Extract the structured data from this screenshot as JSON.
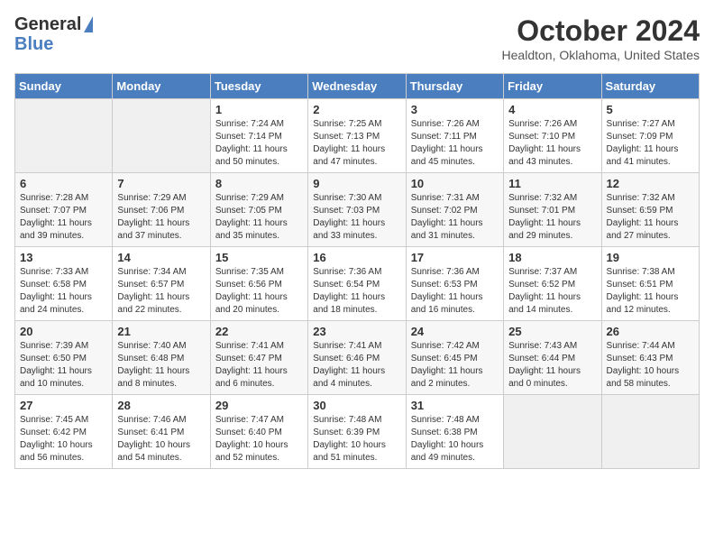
{
  "header": {
    "logo_general": "General",
    "logo_blue": "Blue",
    "title": "October 2024",
    "location": "Healdton, Oklahoma, United States"
  },
  "weekdays": [
    "Sunday",
    "Monday",
    "Tuesday",
    "Wednesday",
    "Thursday",
    "Friday",
    "Saturday"
  ],
  "weeks": [
    [
      {
        "day": "",
        "sunrise": "",
        "sunset": "",
        "daylight": ""
      },
      {
        "day": "",
        "sunrise": "",
        "sunset": "",
        "daylight": ""
      },
      {
        "day": "1",
        "sunrise": "Sunrise: 7:24 AM",
        "sunset": "Sunset: 7:14 PM",
        "daylight": "Daylight: 11 hours and 50 minutes."
      },
      {
        "day": "2",
        "sunrise": "Sunrise: 7:25 AM",
        "sunset": "Sunset: 7:13 PM",
        "daylight": "Daylight: 11 hours and 47 minutes."
      },
      {
        "day": "3",
        "sunrise": "Sunrise: 7:26 AM",
        "sunset": "Sunset: 7:11 PM",
        "daylight": "Daylight: 11 hours and 45 minutes."
      },
      {
        "day": "4",
        "sunrise": "Sunrise: 7:26 AM",
        "sunset": "Sunset: 7:10 PM",
        "daylight": "Daylight: 11 hours and 43 minutes."
      },
      {
        "day": "5",
        "sunrise": "Sunrise: 7:27 AM",
        "sunset": "Sunset: 7:09 PM",
        "daylight": "Daylight: 11 hours and 41 minutes."
      }
    ],
    [
      {
        "day": "6",
        "sunrise": "Sunrise: 7:28 AM",
        "sunset": "Sunset: 7:07 PM",
        "daylight": "Daylight: 11 hours and 39 minutes."
      },
      {
        "day": "7",
        "sunrise": "Sunrise: 7:29 AM",
        "sunset": "Sunset: 7:06 PM",
        "daylight": "Daylight: 11 hours and 37 minutes."
      },
      {
        "day": "8",
        "sunrise": "Sunrise: 7:29 AM",
        "sunset": "Sunset: 7:05 PM",
        "daylight": "Daylight: 11 hours and 35 minutes."
      },
      {
        "day": "9",
        "sunrise": "Sunrise: 7:30 AM",
        "sunset": "Sunset: 7:03 PM",
        "daylight": "Daylight: 11 hours and 33 minutes."
      },
      {
        "day": "10",
        "sunrise": "Sunrise: 7:31 AM",
        "sunset": "Sunset: 7:02 PM",
        "daylight": "Daylight: 11 hours and 31 minutes."
      },
      {
        "day": "11",
        "sunrise": "Sunrise: 7:32 AM",
        "sunset": "Sunset: 7:01 PM",
        "daylight": "Daylight: 11 hours and 29 minutes."
      },
      {
        "day": "12",
        "sunrise": "Sunrise: 7:32 AM",
        "sunset": "Sunset: 6:59 PM",
        "daylight": "Daylight: 11 hours and 27 minutes."
      }
    ],
    [
      {
        "day": "13",
        "sunrise": "Sunrise: 7:33 AM",
        "sunset": "Sunset: 6:58 PM",
        "daylight": "Daylight: 11 hours and 24 minutes."
      },
      {
        "day": "14",
        "sunrise": "Sunrise: 7:34 AM",
        "sunset": "Sunset: 6:57 PM",
        "daylight": "Daylight: 11 hours and 22 minutes."
      },
      {
        "day": "15",
        "sunrise": "Sunrise: 7:35 AM",
        "sunset": "Sunset: 6:56 PM",
        "daylight": "Daylight: 11 hours and 20 minutes."
      },
      {
        "day": "16",
        "sunrise": "Sunrise: 7:36 AM",
        "sunset": "Sunset: 6:54 PM",
        "daylight": "Daylight: 11 hours and 18 minutes."
      },
      {
        "day": "17",
        "sunrise": "Sunrise: 7:36 AM",
        "sunset": "Sunset: 6:53 PM",
        "daylight": "Daylight: 11 hours and 16 minutes."
      },
      {
        "day": "18",
        "sunrise": "Sunrise: 7:37 AM",
        "sunset": "Sunset: 6:52 PM",
        "daylight": "Daylight: 11 hours and 14 minutes."
      },
      {
        "day": "19",
        "sunrise": "Sunrise: 7:38 AM",
        "sunset": "Sunset: 6:51 PM",
        "daylight": "Daylight: 11 hours and 12 minutes."
      }
    ],
    [
      {
        "day": "20",
        "sunrise": "Sunrise: 7:39 AM",
        "sunset": "Sunset: 6:50 PM",
        "daylight": "Daylight: 11 hours and 10 minutes."
      },
      {
        "day": "21",
        "sunrise": "Sunrise: 7:40 AM",
        "sunset": "Sunset: 6:48 PM",
        "daylight": "Daylight: 11 hours and 8 minutes."
      },
      {
        "day": "22",
        "sunrise": "Sunrise: 7:41 AM",
        "sunset": "Sunset: 6:47 PM",
        "daylight": "Daylight: 11 hours and 6 minutes."
      },
      {
        "day": "23",
        "sunrise": "Sunrise: 7:41 AM",
        "sunset": "Sunset: 6:46 PM",
        "daylight": "Daylight: 11 hours and 4 minutes."
      },
      {
        "day": "24",
        "sunrise": "Sunrise: 7:42 AM",
        "sunset": "Sunset: 6:45 PM",
        "daylight": "Daylight: 11 hours and 2 minutes."
      },
      {
        "day": "25",
        "sunrise": "Sunrise: 7:43 AM",
        "sunset": "Sunset: 6:44 PM",
        "daylight": "Daylight: 11 hours and 0 minutes."
      },
      {
        "day": "26",
        "sunrise": "Sunrise: 7:44 AM",
        "sunset": "Sunset: 6:43 PM",
        "daylight": "Daylight: 10 hours and 58 minutes."
      }
    ],
    [
      {
        "day": "27",
        "sunrise": "Sunrise: 7:45 AM",
        "sunset": "Sunset: 6:42 PM",
        "daylight": "Daylight: 10 hours and 56 minutes."
      },
      {
        "day": "28",
        "sunrise": "Sunrise: 7:46 AM",
        "sunset": "Sunset: 6:41 PM",
        "daylight": "Daylight: 10 hours and 54 minutes."
      },
      {
        "day": "29",
        "sunrise": "Sunrise: 7:47 AM",
        "sunset": "Sunset: 6:40 PM",
        "daylight": "Daylight: 10 hours and 52 minutes."
      },
      {
        "day": "30",
        "sunrise": "Sunrise: 7:48 AM",
        "sunset": "Sunset: 6:39 PM",
        "daylight": "Daylight: 10 hours and 51 minutes."
      },
      {
        "day": "31",
        "sunrise": "Sunrise: 7:48 AM",
        "sunset": "Sunset: 6:38 PM",
        "daylight": "Daylight: 10 hours and 49 minutes."
      },
      {
        "day": "",
        "sunrise": "",
        "sunset": "",
        "daylight": ""
      },
      {
        "day": "",
        "sunrise": "",
        "sunset": "",
        "daylight": ""
      }
    ]
  ]
}
